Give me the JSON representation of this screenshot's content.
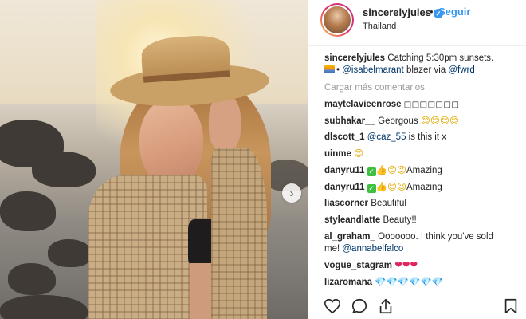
{
  "post": {
    "username": "sincerelyjules",
    "verified_mark": "✓",
    "dot": "•",
    "follow_label": "Seguir",
    "location": "Thailand",
    "next_icon": "›"
  },
  "caption": {
    "username": "sincerelyjules",
    "text_1": "Catching 5:30pm sunsets.",
    "sunset_icon": "sunset-emoji",
    "text_2": "•",
    "mention_1": "@isabelmarant",
    "text_3": "blazer via",
    "mention_2": "@fwrd"
  },
  "load_more": "Cargar más comentarios",
  "comments": [
    {
      "user": "maytelavieenrose",
      "text": "□□□□□□□"
    },
    {
      "user": "subhakar__",
      "text": "Georgous",
      "emoji": "😊😊😊😊"
    },
    {
      "user": "dlscott_1",
      "mention": "@caz_55",
      "text": "is this it x"
    },
    {
      "user": "uinme",
      "emoji": "😍"
    },
    {
      "user": "danyru11",
      "check": "✓",
      "emoji": "👍😊😉",
      "text": "Amazing"
    },
    {
      "user": "danyru11",
      "check": "✓",
      "emoji": "👍😊😉",
      "text": "Amazing"
    },
    {
      "user": "liascorner",
      "text": "Beautiful"
    },
    {
      "user": "styleandlatte",
      "text": "Beauty!!"
    },
    {
      "user": "al_graham_",
      "text": "Ooooooo. I think you've sold",
      "text_2": "me!",
      "mention": "@annabelfalco"
    },
    {
      "user": "vogue_stagram",
      "emoji": "❤❤❤"
    },
    {
      "user": "lizaromana",
      "emoji": "💎💎💎💎💎💎"
    }
  ],
  "icons": {
    "like": "heart-icon",
    "comment": "comment-icon",
    "share": "share-icon",
    "save": "bookmark-icon"
  },
  "colors": {
    "link_blue": "#3897f0",
    "mention_blue": "#003569",
    "muted_gray": "#999999",
    "text": "#262626"
  }
}
